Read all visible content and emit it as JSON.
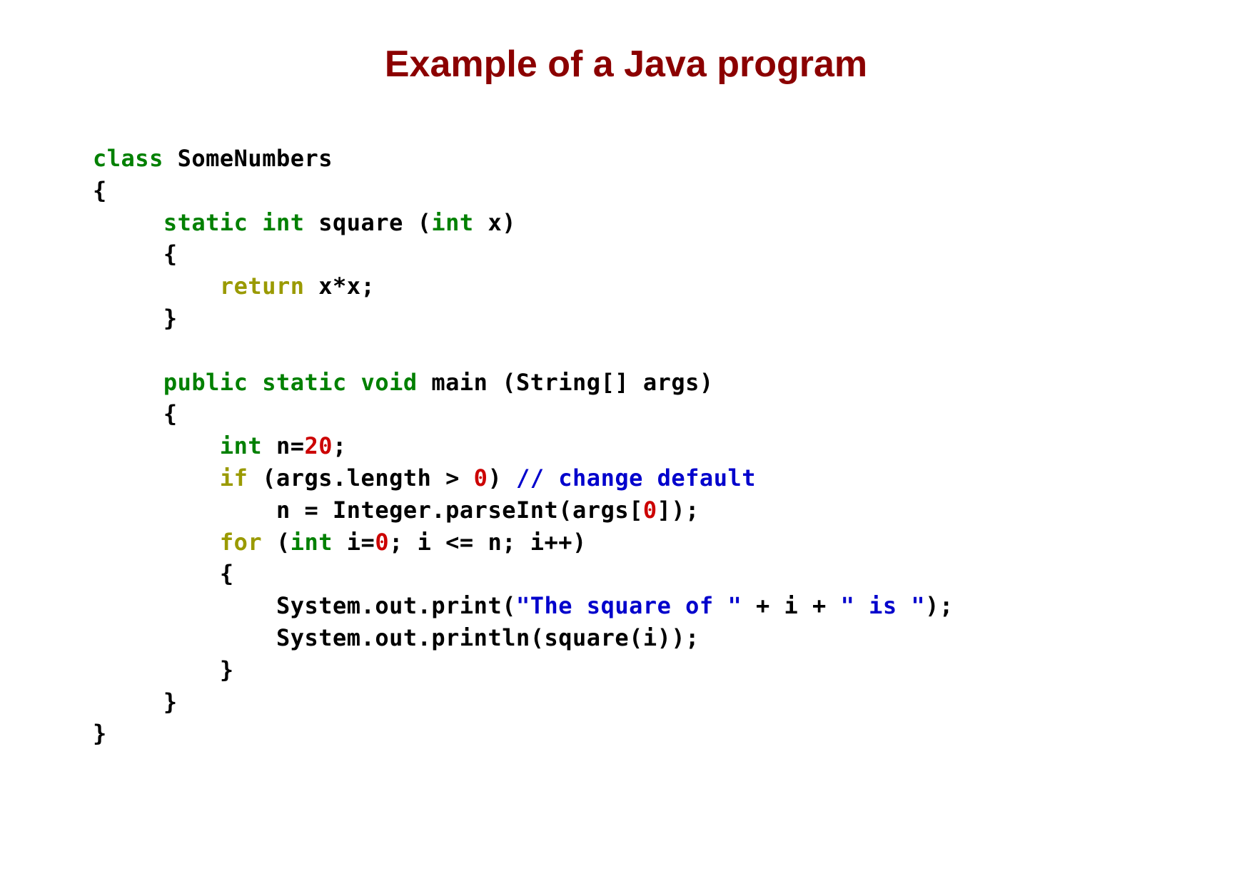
{
  "title": "Example of a Java program",
  "code": {
    "l1_kw_class": "class",
    "l1_name": " SomeNumbers",
    "l2": "{",
    "l3_ind": "     ",
    "l3_kw_static": "static",
    "l3_sp1": " ",
    "l3_kw_int": "int",
    "l3_text1": " square (",
    "l3_kw_int2": "int",
    "l3_text2": " x)",
    "l4": "     {",
    "l5_ind": "         ",
    "l5_kw_return": "return",
    "l5_text": " x*x;",
    "l6": "     }",
    "l7": "",
    "l8_ind": "     ",
    "l8_kw_public": "public",
    "l8_sp1": " ",
    "l8_kw_static": "static",
    "l8_sp2": " ",
    "l8_kw_void": "void",
    "l8_text": " main (String[] args)",
    "l9": "     {",
    "l10_ind": "         ",
    "l10_kw_int": "int",
    "l10_text1": " n=",
    "l10_num": "20",
    "l10_text2": ";",
    "l11_ind": "         ",
    "l11_kw_if": "if",
    "l11_text1": " (args.length > ",
    "l11_num0": "0",
    "l11_text2": ") ",
    "l11_comment": "// change default",
    "l12_ind": "             ",
    "l12_text1": "n = Integer.parseInt(args[",
    "l12_num0": "0",
    "l12_text2": "]);",
    "l13_ind": "         ",
    "l13_kw_for": "for",
    "l13_text1": " (",
    "l13_kw_int": "int",
    "l13_text2": " i=",
    "l13_num0": "0",
    "l13_text3": "; i <= n; i++)",
    "l14": "         {",
    "l15_ind": "             ",
    "l15_text1": "System.out.print(",
    "l15_str1": "\"The square of \"",
    "l15_text2": " + i + ",
    "l15_str2": "\" is \"",
    "l15_text3": ");",
    "l16": "             System.out.println(square(i));",
    "l17": "         }",
    "l18": "     }",
    "l19": "}"
  }
}
